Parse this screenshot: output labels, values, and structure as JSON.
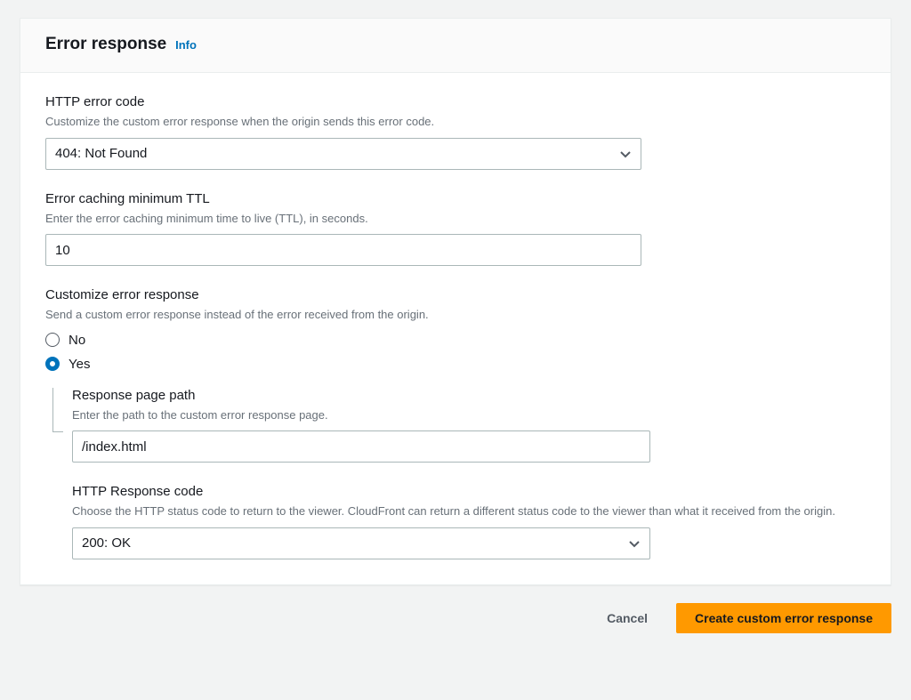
{
  "header": {
    "title": "Error response",
    "info_link": "Info"
  },
  "http_error_code": {
    "label": "HTTP error code",
    "hint": "Customize the custom error response when the origin sends this error code.",
    "value": "404: Not Found"
  },
  "ttl": {
    "label": "Error caching minimum TTL",
    "hint": "Enter the error caching minimum time to live (TTL), in seconds.",
    "value": "10"
  },
  "customize": {
    "label": "Customize error response",
    "hint": "Send a custom error response instead of the error received from the origin.",
    "options": {
      "no": "No",
      "yes": "Yes"
    },
    "selected": "yes"
  },
  "response_path": {
    "label": "Response page path",
    "hint": "Enter the path to the custom error response page.",
    "value": "/index.html"
  },
  "response_code": {
    "label": "HTTP Response code",
    "hint": "Choose the HTTP status code to return to the viewer. CloudFront can return a different status code to the viewer than what it received from the origin.",
    "value": "200: OK"
  },
  "actions": {
    "cancel": "Cancel",
    "create": "Create custom error response"
  }
}
